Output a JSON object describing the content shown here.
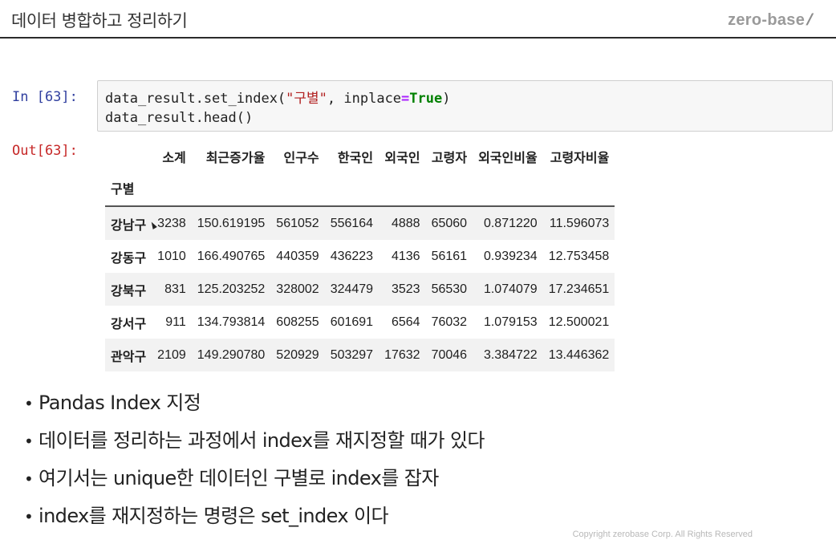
{
  "header": {
    "title": "데이터 병합하고 정리하기",
    "brand": "zero-base",
    "brand_slash": "/"
  },
  "cell_in": {
    "prompt": "In [63]:",
    "line1": {
      "t1": "data_result.set_index(",
      "str": "\"구별\"",
      "t2": ", inplace",
      "op": "=",
      "kw": "True",
      "t3": ")"
    },
    "line2": "data_result.head()"
  },
  "cell_out": {
    "prompt": "Out[63]:",
    "index_name": "구별",
    "columns": [
      "소계",
      "최근증가율",
      "인구수",
      "한국인",
      "외국인",
      "고령자",
      "외국인비율",
      "고령자비율"
    ],
    "rows": [
      {
        "index": "강남구",
        "values": [
          "3238",
          "150.619195",
          "561052",
          "556164",
          "4888",
          "65060",
          "0.871220",
          "11.596073"
        ]
      },
      {
        "index": "강동구",
        "values": [
          "1010",
          "166.490765",
          "440359",
          "436223",
          "4136",
          "56161",
          "0.939234",
          "12.753458"
        ]
      },
      {
        "index": "강북구",
        "values": [
          "831",
          "125.203252",
          "328002",
          "324479",
          "3523",
          "56530",
          "1.074079",
          "17.234651"
        ]
      },
      {
        "index": "강서구",
        "values": [
          "911",
          "134.793814",
          "608255",
          "601691",
          "6564",
          "76032",
          "1.079153",
          "12.500021"
        ]
      },
      {
        "index": "관악구",
        "values": [
          "2109",
          "149.290780",
          "520929",
          "503297",
          "17632",
          "70046",
          "3.384722",
          "13.446362"
        ]
      }
    ]
  },
  "bullets": [
    "Pandas Index 지정",
    "데이터를 정리하는 과정에서 index를 재지정할 때가 있다",
    "여기서는 unique한 데이터인 구별로 index를 잡자",
    "index를 재지정하는 명령은 set_index 이다"
  ],
  "bullet_glyph": "•",
  "footer": {
    "copyright": "Copyright zerobase Corp. All Rights Reserved"
  }
}
